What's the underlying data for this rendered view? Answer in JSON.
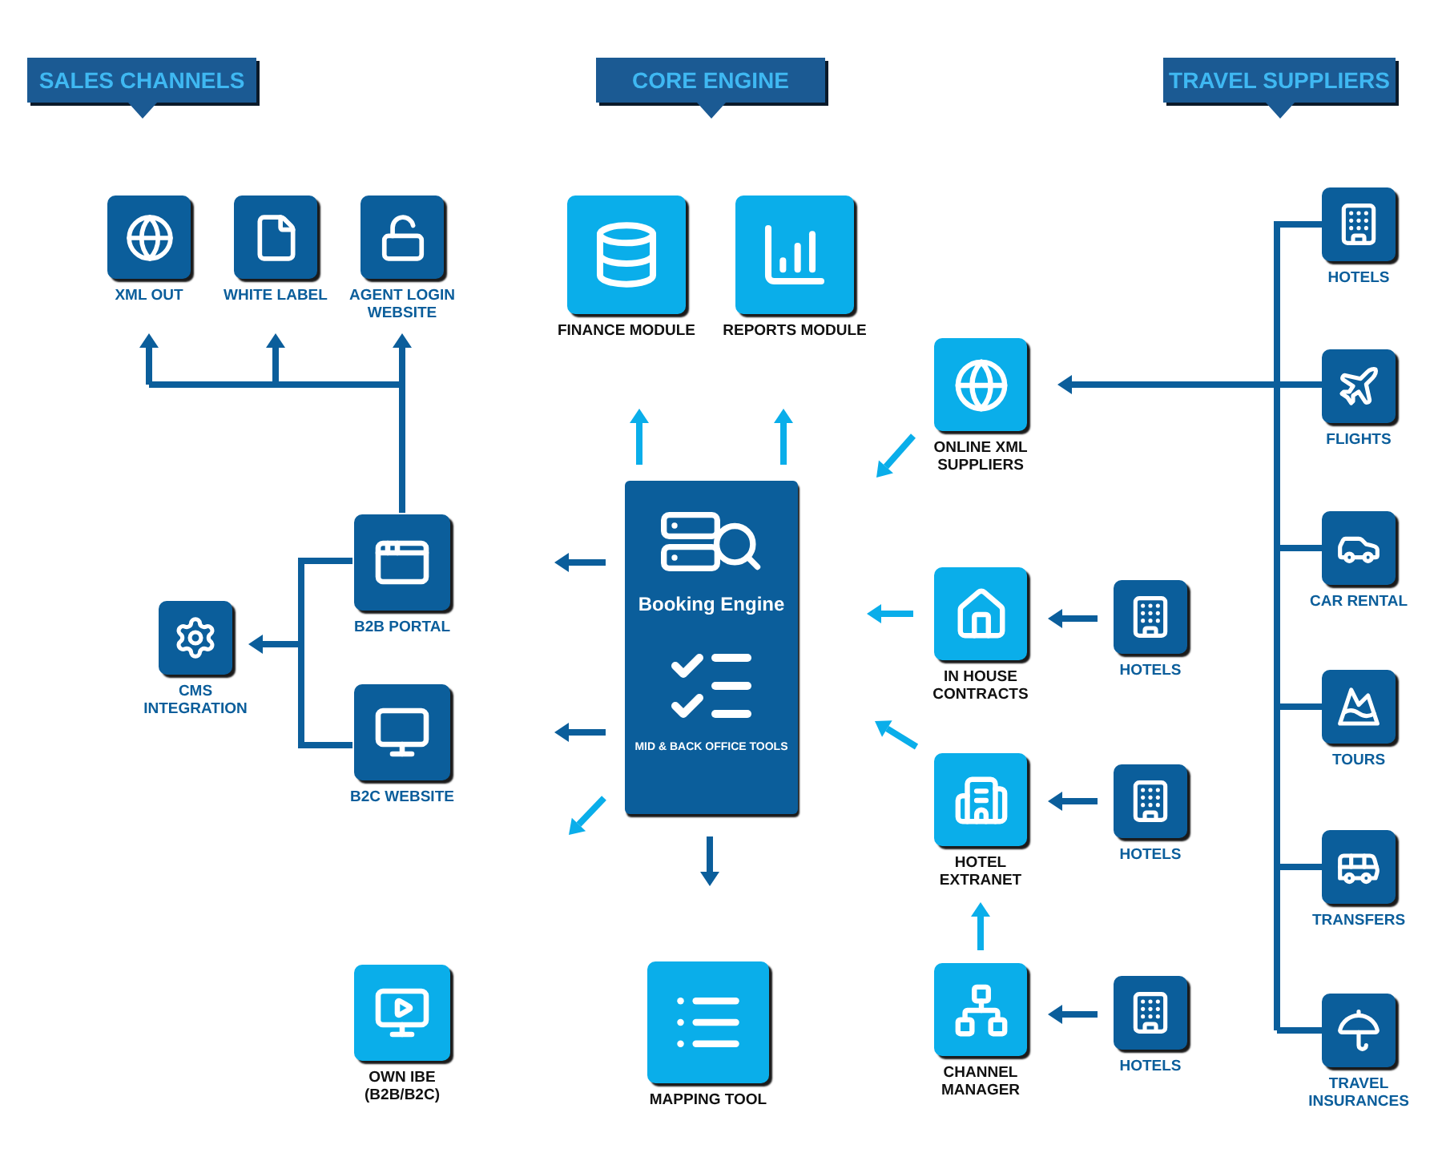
{
  "sections": [
    {
      "title": "SALES CHANNELS"
    },
    {
      "title": "CORE ENGINE"
    },
    {
      "title": "TRAVEL SUPPLIERS"
    }
  ],
  "nodes": [
    {
      "label": "XML OUT",
      "kind": "dark"
    },
    {
      "label": "WHITE LABEL",
      "kind": "dark"
    },
    {
      "label": "AGENT LOGIN\nWEBSITE",
      "kind": "dark"
    },
    {
      "label": "FINANCE MODULE",
      "kind": "light"
    },
    {
      "label": "REPORTS MODULE",
      "kind": "light"
    },
    {
      "label": "B2B PORTAL",
      "kind": "dark"
    },
    {
      "label": "CMS\nINTEGRATION",
      "kind": "dark"
    },
    {
      "label": "B2C WEBSITE",
      "kind": "dark"
    },
    {
      "label": "OWN IBE\n(B2B/B2C)",
      "kind": "light"
    },
    {
      "label": "MAPPING TOOL",
      "kind": "light"
    },
    {
      "label": "ONLINE XML\nSUPPLIERS",
      "kind": "light"
    },
    {
      "label": "IN HOUSE\nCONTRACTS",
      "kind": "light"
    },
    {
      "label": "HOTEL\nEXTRANET",
      "kind": "light"
    },
    {
      "label": "CHANNEL\nMANAGER",
      "kind": "light"
    },
    {
      "label": "HOTELS",
      "kind": "dark"
    },
    {
      "label": "HOTELS",
      "kind": "dark"
    },
    {
      "label": "HOTELS",
      "kind": "dark"
    },
    {
      "label": "HOTELS",
      "kind": "dark"
    },
    {
      "label": "FLIGHTS",
      "kind": "dark"
    },
    {
      "label": "CAR RENTAL",
      "kind": "dark"
    },
    {
      "label": "TOURS",
      "kind": "dark"
    },
    {
      "label": "TRANSFERS",
      "kind": "dark"
    },
    {
      "label": "TRAVEL\nINSURANCES",
      "kind": "dark"
    }
  ],
  "booking_engine": {
    "title": "Booking Engine",
    "subtitle": "MID & BACK OFFICE TOOLS"
  }
}
